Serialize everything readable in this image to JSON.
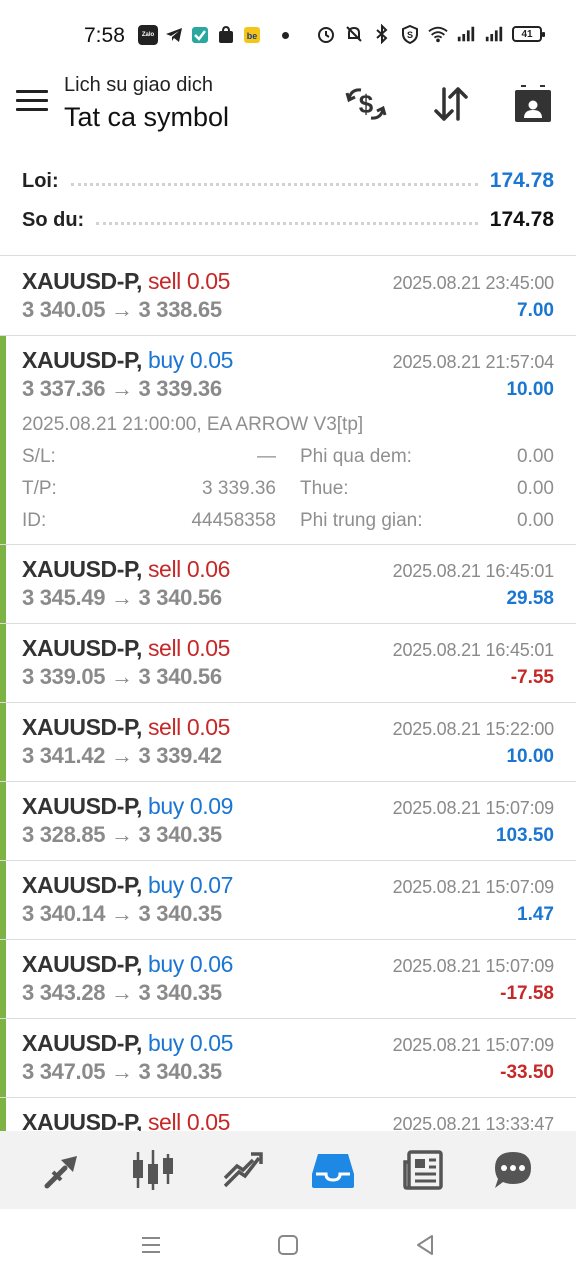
{
  "status_bar": {
    "time": "7:58",
    "battery": "41",
    "apps": [
      "Zalo",
      "Telegram",
      "Check",
      "Shop",
      "Be"
    ]
  },
  "header": {
    "subtitle": "Lich su giao dich",
    "title": "Tat ca symbol",
    "icons": [
      "deposit-icon",
      "sort-icon",
      "calendar-icon"
    ]
  },
  "summary": {
    "profit_label": "Loi:",
    "profit_value": "174.78",
    "balance_label": "So du:",
    "balance_value": "174.78"
  },
  "colors": {
    "sell": "#c62828",
    "buy": "#1a76d2",
    "accent_bar": "#7cb342",
    "muted": "#8a8a8a"
  },
  "trades": [
    {
      "symbol": "XAUUSD-P,",
      "side": "sell",
      "volume": "0.05",
      "prices": "3 340.05 → 3 338.65",
      "date": "2025.08.21 23:45:00",
      "profit": "7.00",
      "positive": true,
      "bar": false
    },
    {
      "symbol": "XAUUSD-P,",
      "side": "buy",
      "volume": "0.05",
      "prices": "3 337.36 → 3 339.36",
      "date": "2025.08.21 21:57:04",
      "profit": "10.00",
      "positive": true,
      "bar": true,
      "detail": {
        "comment": "2025.08.21 21:00:00, EA ARROW V3[tp]",
        "sl_label": "S/L:",
        "sl_value": "—",
        "tp_label": "T/P:",
        "tp_value": "3 339.36",
        "id_label": "ID:",
        "id_value": "44458358",
        "swap_label": "Phi qua dem:",
        "swap_value": "0.00",
        "tax_label": "Thue:",
        "tax_value": "0.00",
        "fee_label": "Phi trung gian:",
        "fee_value": "0.00"
      }
    },
    {
      "symbol": "XAUUSD-P,",
      "side": "sell",
      "volume": "0.06",
      "prices": "3 345.49 → 3 340.56",
      "date": "2025.08.21 16:45:01",
      "profit": "29.58",
      "positive": true,
      "bar": true
    },
    {
      "symbol": "XAUUSD-P,",
      "side": "sell",
      "volume": "0.05",
      "prices": "3 339.05 → 3 340.56",
      "date": "2025.08.21 16:45:01",
      "profit": "-7.55",
      "positive": false,
      "bar": true
    },
    {
      "symbol": "XAUUSD-P,",
      "side": "sell",
      "volume": "0.05",
      "prices": "3 341.42 → 3 339.42",
      "date": "2025.08.21 15:22:00",
      "profit": "10.00",
      "positive": true,
      "bar": true
    },
    {
      "symbol": "XAUUSD-P,",
      "side": "buy",
      "volume": "0.09",
      "prices": "3 328.85 → 3 340.35",
      "date": "2025.08.21 15:07:09",
      "profit": "103.50",
      "positive": true,
      "bar": true
    },
    {
      "symbol": "XAUUSD-P,",
      "side": "buy",
      "volume": "0.07",
      "prices": "3 340.14 → 3 340.35",
      "date": "2025.08.21 15:07:09",
      "profit": "1.47",
      "positive": true,
      "bar": true
    },
    {
      "symbol": "XAUUSD-P,",
      "side": "buy",
      "volume": "0.06",
      "prices": "3 343.28 → 3 340.35",
      "date": "2025.08.21 15:07:09",
      "profit": "-17.58",
      "positive": false,
      "bar": true
    },
    {
      "symbol": "XAUUSD-P,",
      "side": "buy",
      "volume": "0.05",
      "prices": "3 347.05 → 3 340.35",
      "date": "2025.08.21 15:07:09",
      "profit": "-33.50",
      "positive": false,
      "bar": true
    },
    {
      "symbol": "XAUUSD-P,",
      "side": "sell",
      "volume": "0.05",
      "prices": "",
      "date": "2025.08.21 13:33:47",
      "profit": "",
      "positive": true,
      "bar": true
    }
  ],
  "bottom_nav": [
    "quotes-icon",
    "chart-icon",
    "trade-icon",
    "history-icon",
    "news-icon",
    "messages-icon"
  ],
  "bottom_nav_active": 3
}
